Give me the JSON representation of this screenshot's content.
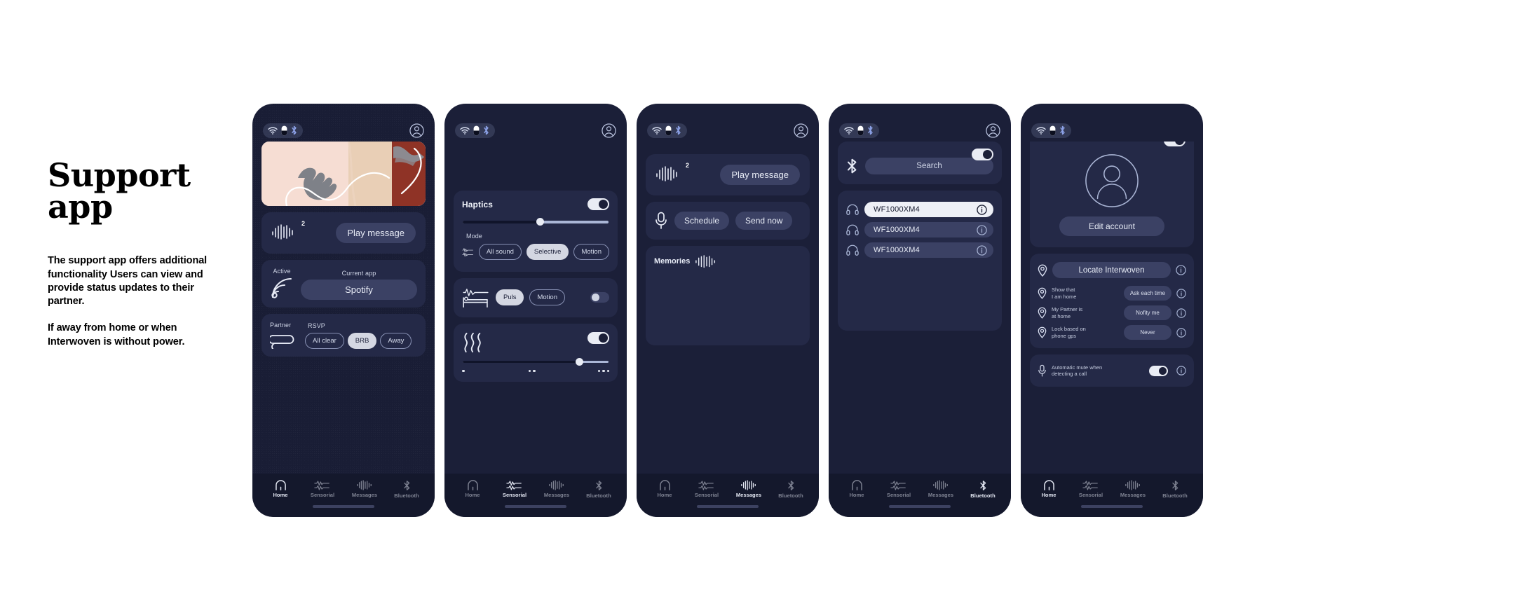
{
  "intro": {
    "title": "Support app",
    "paragraphs": [
      "The support app offers additional functionality Users can view and provide status updates to their partner.",
      "If away from home or when Interwoven is without power."
    ]
  },
  "colors": {
    "page_bg": "#ffffff",
    "phone_bg": "#1b1f38",
    "card_bg": "#242947",
    "nav_bg": "#14182c",
    "accent_light": "#d4d7e2",
    "pill_bg": "#3b4164",
    "text_primary": "#e8ecf6",
    "hero_blush": "#f6ded4",
    "hero_tan": "#e8cdb4",
    "hero_maroon": "#8f3326"
  },
  "statusbar": {
    "icons": [
      "wifi-icon",
      "battery-icon",
      "bluetooth-icon"
    ],
    "account_icon": "account-circle-icon"
  },
  "nav": {
    "items": [
      {
        "label": "Home",
        "icon": "home-icon"
      },
      {
        "label": "Sensorial",
        "icon": "sensorial-waveform-icon"
      },
      {
        "label": "Messages",
        "icon": "messages-waveform-icon"
      },
      {
        "label": "Bluetooth",
        "icon": "bluetooth-icon"
      }
    ]
  },
  "phones": [
    {
      "id": "home",
      "active_tab": "Home",
      "hero": {
        "alt": "hands-reaching-collage-image"
      },
      "message_card": {
        "waveform_icon": "audio-waveform-icon",
        "badge": "2",
        "play_label": "Play message"
      },
      "activity_card": {
        "signal_icon": "broadcast-signal-icon",
        "status_label": "Active",
        "current_app_label": "Current app",
        "current_app_value": "Spotify"
      },
      "partner_card": {
        "partner_label": "Partner",
        "partner_icon": "interwoven-loop-icon",
        "rsvp_label": "RSVP",
        "options": [
          {
            "label": "All clear",
            "selected": false
          },
          {
            "label": "BRB",
            "selected": true
          },
          {
            "label": "Away",
            "selected": false
          }
        ]
      }
    },
    {
      "id": "sensorial",
      "active_tab": "Sensorial",
      "haptics_card": {
        "title": "Haptics",
        "toggle_on": true,
        "slider_percent": 53,
        "mode_label": "Mode",
        "mode_icon": "dual-waveform-icon",
        "modes": [
          {
            "label": "All sound",
            "selected": false
          },
          {
            "label": "Selective",
            "selected": true
          },
          {
            "label": "Motion",
            "selected": false
          }
        ]
      },
      "sleep_card": {
        "icon": "sleep-bed-waveform-icon",
        "toggle_on": false,
        "modes": [
          {
            "label": "Puls",
            "selected": true
          },
          {
            "label": "Motion",
            "selected": false
          }
        ]
      },
      "heat_card": {
        "icon": "heat-waves-icon",
        "toggle_on": true,
        "slider_percent": 80,
        "dot_groups": [
          1,
          2,
          3
        ]
      }
    },
    {
      "id": "messages",
      "active_tab": "Messages",
      "message_card": {
        "waveform_icon": "audio-waveform-icon",
        "badge": "2",
        "play_label": "Play message"
      },
      "record_card": {
        "mic_icon": "microphone-icon",
        "actions": [
          {
            "label": "Schedule"
          },
          {
            "label": "Send now"
          }
        ]
      },
      "memories_card": {
        "title": "Memories",
        "waveform_icon": "audio-waveform-icon"
      }
    },
    {
      "id": "bluetooth",
      "active_tab": "Bluetooth",
      "search_card": {
        "bluetooth_icon": "bluetooth-icon",
        "search_placeholder": "Search",
        "toggle_on": true
      },
      "devices_card": {
        "devices": [
          {
            "name": "WF1000XM4",
            "icon": "headphones-icon",
            "selected": true,
            "info": "i"
          },
          {
            "name": "WF1000XM4",
            "icon": "headphones-icon",
            "selected": false,
            "info": "i"
          },
          {
            "name": "WF1000XM4",
            "icon": "headphones-icon",
            "selected": false,
            "info": "i"
          }
        ]
      }
    },
    {
      "id": "account",
      "active_tab": "Home",
      "account_card": {
        "avatar_icon": "account-circle-large-icon",
        "edit_label": "Edit account",
        "toggle_on": true
      },
      "location_card": {
        "locate_label": "Locate Interwoven",
        "locate_icon": "location-pin-icon",
        "rows": [
          {
            "icon": "location-pin-icon",
            "label": "Show that\nI am home",
            "value": "Ask each time",
            "info": "i"
          },
          {
            "icon": "location-pin-icon",
            "label": "My Partner is\nat home",
            "value": "Nofity me",
            "info": "i"
          },
          {
            "icon": "location-pin-icon",
            "label": "Lock based on\nphone gps",
            "value": "Never",
            "info": "i"
          }
        ]
      },
      "mute_card": {
        "icon": "microphone-icon",
        "label": "Automatic mute when\ndetecting a call",
        "toggle_on": true,
        "info": "i"
      }
    }
  ]
}
